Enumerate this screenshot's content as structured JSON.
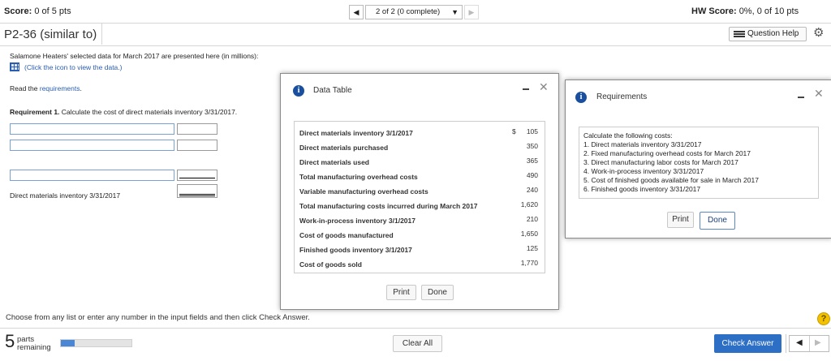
{
  "header": {
    "score_label": "Score:",
    "score_value": "0 of 5 pts",
    "nav_text": "2 of 2 (0 complete)",
    "hw_score_label": "HW Score:",
    "hw_score_value": "0%, 0 of 10 pts",
    "problem_title": "P2-36 (similar to)",
    "question_help": "Question Help"
  },
  "question": {
    "intro": "Salamone Heaters' selected data for March 2017 are presented here (in millions):",
    "data_link": "(Click the icon to view the data.)",
    "read_prefix": "Read the ",
    "read_link": "requirements",
    "read_suffix": ".",
    "req_label": "Requirement 1.",
    "req_text": " Calculate the cost of direct materials inventory 3/31/2017.",
    "final_row_label": "Direct materials inventory 3/31/2017"
  },
  "data_table": {
    "title": "Data Table",
    "currency": "$",
    "rows": [
      {
        "label": "Direct materials inventory 3/1/2017",
        "value": "105"
      },
      {
        "label": "Direct materials purchased",
        "value": "350"
      },
      {
        "label": "Direct materials used",
        "value": "365"
      },
      {
        "label": "Total manufacturing overhead costs",
        "value": "490"
      },
      {
        "label": "Variable manufacturing overhead costs",
        "value": "240"
      },
      {
        "label": "Total manufacturing costs incurred during March 2017",
        "value": "1,620"
      },
      {
        "label": "Work-in-process inventory 3/1/2017",
        "value": "210"
      },
      {
        "label": "Cost of goods manufactured",
        "value": "1,650"
      },
      {
        "label": "Finished goods inventory 3/1/2017",
        "value": "125"
      },
      {
        "label": "Cost of goods sold",
        "value": "1,770"
      }
    ],
    "print": "Print",
    "done": "Done"
  },
  "requirements": {
    "title": "Requirements",
    "lines": [
      "Calculate the following costs:",
      "1. Direct materials inventory 3/31/2017",
      "2. Fixed manufacturing overhead costs for March 2017",
      "3. Direct manufacturing labor costs for March 2017",
      "4. Work-in-process inventory 3/31/2017",
      "5. Cost of finished goods available for sale in March 2017",
      "6. Finished goods inventory 3/31/2017"
    ],
    "print": "Print",
    "done": "Done"
  },
  "footer": {
    "instruction": "Choose from any list or enter any number in the input fields and then click Check Answer.",
    "parts_count": "5",
    "parts_label_1": "parts",
    "parts_label_2": "remaining",
    "progress": 0.2,
    "clear_all": "Clear All",
    "check_answer": "Check Answer",
    "help_icon": "?"
  },
  "colors": {
    "accent": "#1a4fa0",
    "link": "#2a5db0",
    "input_border": "#7aa0d8",
    "progress_fill": "#4a86d6"
  }
}
